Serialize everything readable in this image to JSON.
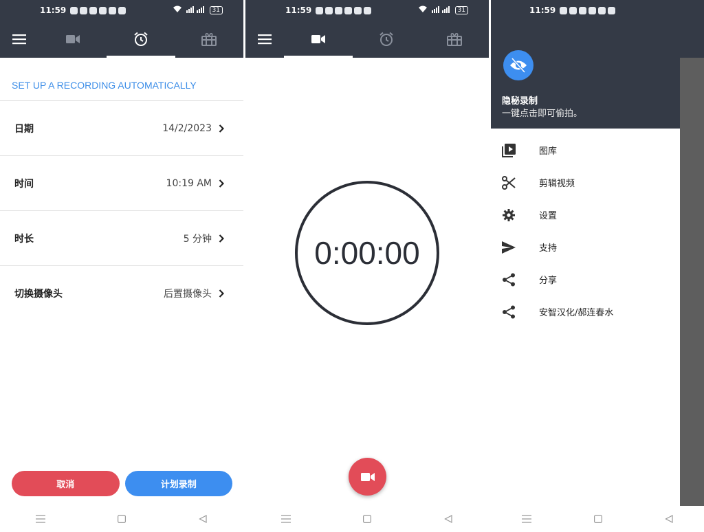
{
  "status": {
    "time": "11:59",
    "battery": "31"
  },
  "scheduler": {
    "section_title": "SET UP A RECORDING AUTOMATICALLY",
    "rows": [
      {
        "label": "日期",
        "value": "14/2/2023"
      },
      {
        "label": "时间",
        "value": "10:19 AM"
      },
      {
        "label": "时长",
        "value": "5 分钟"
      },
      {
        "label": "切换摄像头",
        "value": "后置摄像头"
      }
    ],
    "cancel_label": "取消",
    "schedule_label": "计划录制"
  },
  "recorder": {
    "timer": "0:00:00"
  },
  "drawer": {
    "title": "隐秘录制",
    "subtitle": "一键点击即可偷拍。",
    "items": [
      {
        "label": "图库",
        "icon": "video-library-icon"
      },
      {
        "label": "剪辑视频",
        "icon": "scissors-icon"
      },
      {
        "label": "设置",
        "icon": "gear-icon"
      },
      {
        "label": "支持",
        "icon": "send-icon"
      },
      {
        "label": "分享",
        "icon": "share-icon"
      },
      {
        "label": "安智汉化/郝连春水",
        "icon": "share-icon"
      }
    ]
  },
  "colors": {
    "toolbar": "#343a46",
    "accent_blue": "#3d8ef0",
    "accent_red": "#e24c58"
  }
}
